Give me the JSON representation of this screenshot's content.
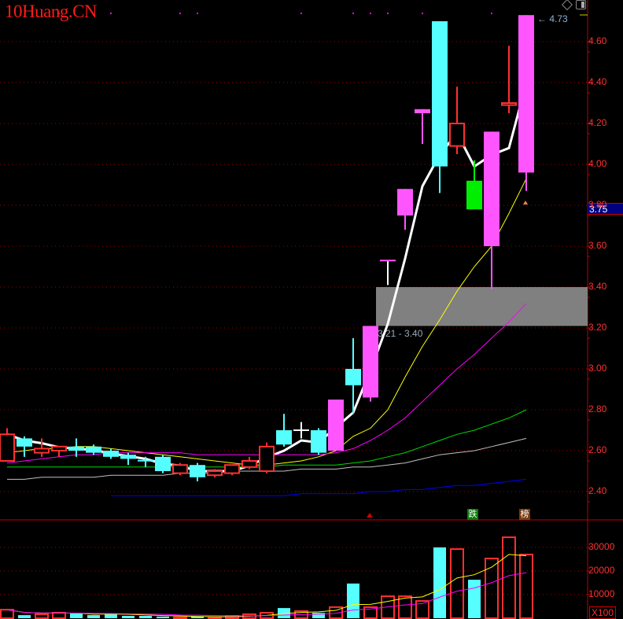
{
  "logo": "10Huang.CN",
  "current_price": "3.75",
  "high_label": "4.73",
  "zone_label": "3.21 - 3.40",
  "volume_unit": "X100",
  "tags": {
    "fall": "跌",
    "rank": "榜"
  },
  "colors": {
    "up": "#ff3030",
    "down": "#55ffff",
    "strong_up": "#ff55ff",
    "limit_down": "#00ee00",
    "doji": "#ffffff",
    "grid": "#a00000",
    "axis": "#c00000"
  },
  "chart_data": {
    "type": "candlestick",
    "price_axis": {
      "ticks": [
        "4.60",
        "4.40",
        "4.20",
        "4.00",
        "3.80",
        "3.60",
        "3.40",
        "3.20",
        "3.00",
        "2.80",
        "2.60",
        "2.40"
      ],
      "ylim": [
        2.34,
        4.8
      ]
    },
    "volume_axis": {
      "ticks": [
        "30000",
        "20000",
        "10000"
      ],
      "ylim": [
        0,
        35000
      ]
    },
    "zone": {
      "low": 3.21,
      "high": 3.4,
      "start_index": 22
    },
    "candles": [
      {
        "o": 2.55,
        "h": 2.71,
        "l": 2.55,
        "c": 2.68,
        "s": "up",
        "v": 3600
      },
      {
        "o": 2.66,
        "h": 2.67,
        "l": 2.57,
        "c": 2.62,
        "s": "down",
        "v": 1300
      },
      {
        "o": 2.59,
        "h": 2.66,
        "l": 2.57,
        "c": 2.61,
        "s": "up",
        "v": 1700
      },
      {
        "o": 2.6,
        "h": 2.62,
        "l": 2.57,
        "c": 2.62,
        "s": "up",
        "v": 2300
      },
      {
        "o": 2.62,
        "h": 2.66,
        "l": 2.57,
        "c": 2.6,
        "s": "down",
        "v": 2000
      },
      {
        "o": 2.62,
        "h": 2.63,
        "l": 2.58,
        "c": 2.59,
        "s": "down",
        "v": 1300
      },
      {
        "o": 2.6,
        "h": 2.61,
        "l": 2.56,
        "c": 2.57,
        "s": "down",
        "v": 1700
      },
      {
        "o": 2.58,
        "h": 2.59,
        "l": 2.53,
        "c": 2.56,
        "s": "down",
        "v": 1000
      },
      {
        "o": 2.555,
        "h": 2.57,
        "l": 2.52,
        "c": 2.55,
        "s": "down",
        "v": 1000
      },
      {
        "o": 2.57,
        "h": 2.58,
        "l": 2.49,
        "c": 2.5,
        "s": "down",
        "v": 700
      },
      {
        "o": 2.49,
        "h": 2.54,
        "l": 2.48,
        "c": 2.53,
        "s": "up",
        "v": 400
      },
      {
        "o": 2.53,
        "h": 2.54,
        "l": 2.45,
        "c": 2.47,
        "s": "down",
        "v": 700
      },
      {
        "o": 2.48,
        "h": 2.51,
        "l": 2.47,
        "c": 2.5,
        "s": "up",
        "v": 400
      },
      {
        "o": 2.49,
        "h": 2.53,
        "l": 2.48,
        "c": 2.53,
        "s": "up",
        "v": 1000
      },
      {
        "o": 2.52,
        "h": 2.57,
        "l": 2.51,
        "c": 2.55,
        "s": "up",
        "v": 1700
      },
      {
        "o": 2.5,
        "h": 2.64,
        "l": 2.49,
        "c": 2.62,
        "s": "up",
        "v": 2300
      },
      {
        "o": 2.7,
        "h": 2.78,
        "l": 2.62,
        "c": 2.63,
        "s": "down",
        "v": 4300
      },
      {
        "o": 2.7,
        "h": 2.74,
        "l": 2.66,
        "c": 2.7,
        "s": "doji",
        "v": 3000
      },
      {
        "o": 2.7,
        "h": 2.71,
        "l": 2.58,
        "c": 2.59,
        "s": "down",
        "v": 2300
      },
      {
        "o": 2.6,
        "h": 2.85,
        "l": 2.6,
        "c": 2.85,
        "s": "strong_up",
        "v": 4700
      },
      {
        "o": 3.0,
        "h": 3.15,
        "l": 2.78,
        "c": 2.92,
        "s": "down",
        "v": 14700
      },
      {
        "o": 2.86,
        "h": 3.21,
        "l": 2.84,
        "c": 3.21,
        "s": "strong_up",
        "v": 4700
      },
      {
        "o": 3.53,
        "h": 3.53,
        "l": 3.41,
        "c": 3.53,
        "s": "doji",
        "v": 9300
      },
      {
        "o": 3.75,
        "h": 3.88,
        "l": 3.68,
        "c": 3.88,
        "s": "strong_up",
        "v": 9300
      },
      {
        "o": 4.25,
        "h": 4.27,
        "l": 4.1,
        "c": 4.27,
        "s": "strong_up",
        "v": 7300
      },
      {
        "o": 4.7,
        "h": 4.7,
        "l": 3.86,
        "c": 3.99,
        "s": "down",
        "v": 30000
      },
      {
        "o": 4.09,
        "h": 4.38,
        "l": 4.05,
        "c": 4.2,
        "s": "up",
        "v": 29300
      },
      {
        "o": 3.92,
        "h": 4.02,
        "l": 3.78,
        "c": 3.78,
        "s": "limit_down",
        "v": 16300
      },
      {
        "o": 3.6,
        "h": 4.16,
        "l": 3.39,
        "c": 4.16,
        "s": "strong_up",
        "v": 25300
      },
      {
        "o": 4.29,
        "h": 4.58,
        "l": 4.25,
        "c": 4.3,
        "s": "up",
        "v": 34300
      },
      {
        "o": 3.96,
        "h": 4.73,
        "l": 3.87,
        "c": 4.73,
        "s": "strong_up",
        "v": 27000
      }
    ],
    "ma_lines": [
      {
        "name": "MA3",
        "color": "#ffffff",
        "computed_period": 3
      },
      {
        "name": "yellow",
        "color": "#ffff00",
        "values": [
          2.59,
          2.6,
          2.61,
          2.61,
          2.62,
          2.62,
          2.61,
          2.6,
          2.59,
          2.58,
          2.57,
          2.56,
          2.55,
          2.54,
          2.53,
          2.53,
          2.54,
          2.55,
          2.57,
          2.6,
          2.67,
          2.71,
          2.8,
          2.96,
          3.11,
          3.24,
          3.38,
          3.5,
          3.6,
          3.76,
          3.93
        ]
      },
      {
        "name": "magenta",
        "color": "#ff00ff",
        "values": [
          2.54,
          2.55,
          2.56,
          2.57,
          2.58,
          2.58,
          2.59,
          2.59,
          2.59,
          2.59,
          2.59,
          2.58,
          2.58,
          2.58,
          2.58,
          2.58,
          2.58,
          2.58,
          2.58,
          2.59,
          2.61,
          2.65,
          2.7,
          2.76,
          2.84,
          2.92,
          3.0,
          3.07,
          3.15,
          3.23,
          3.32
        ]
      },
      {
        "name": "green",
        "color": "#00dd00",
        "values": [
          2.52,
          2.52,
          2.52,
          2.52,
          2.52,
          2.52,
          2.52,
          2.52,
          2.52,
          2.52,
          2.52,
          2.52,
          2.52,
          2.52,
          2.52,
          2.52,
          2.53,
          2.53,
          2.53,
          2.53,
          2.54,
          2.55,
          2.57,
          2.59,
          2.62,
          2.65,
          2.68,
          2.7,
          2.73,
          2.76,
          2.8
        ]
      },
      {
        "name": "gray",
        "color": "#c0c0c0",
        "values": [
          2.46,
          2.46,
          2.47,
          2.47,
          2.47,
          2.47,
          2.48,
          2.48,
          2.48,
          2.48,
          2.49,
          2.49,
          2.49,
          2.5,
          2.5,
          2.5,
          2.5,
          2.51,
          2.51,
          2.51,
          2.52,
          2.52,
          2.53,
          2.54,
          2.56,
          2.58,
          2.59,
          2.6,
          2.62,
          2.64,
          2.66
        ]
      },
      {
        "name": "blue",
        "color": "#0000ff",
        "values": [
          null,
          null,
          null,
          null,
          null,
          null,
          2.38,
          2.38,
          2.38,
          2.38,
          2.38,
          2.38,
          2.38,
          2.38,
          2.38,
          2.38,
          2.38,
          2.39,
          2.39,
          2.39,
          2.39,
          2.4,
          2.4,
          2.41,
          2.41,
          2.42,
          2.43,
          2.43,
          2.44,
          2.45,
          2.46
        ]
      }
    ],
    "volume_ma": [
      {
        "name": "VMA5",
        "color": "#ffff00",
        "period": 5
      },
      {
        "name": "VMA10",
        "color": "#ff00ff",
        "period": 10
      }
    ],
    "signal_markers": [
      3,
      6,
      10,
      11,
      17,
      20,
      21,
      22,
      24,
      28
    ]
  }
}
